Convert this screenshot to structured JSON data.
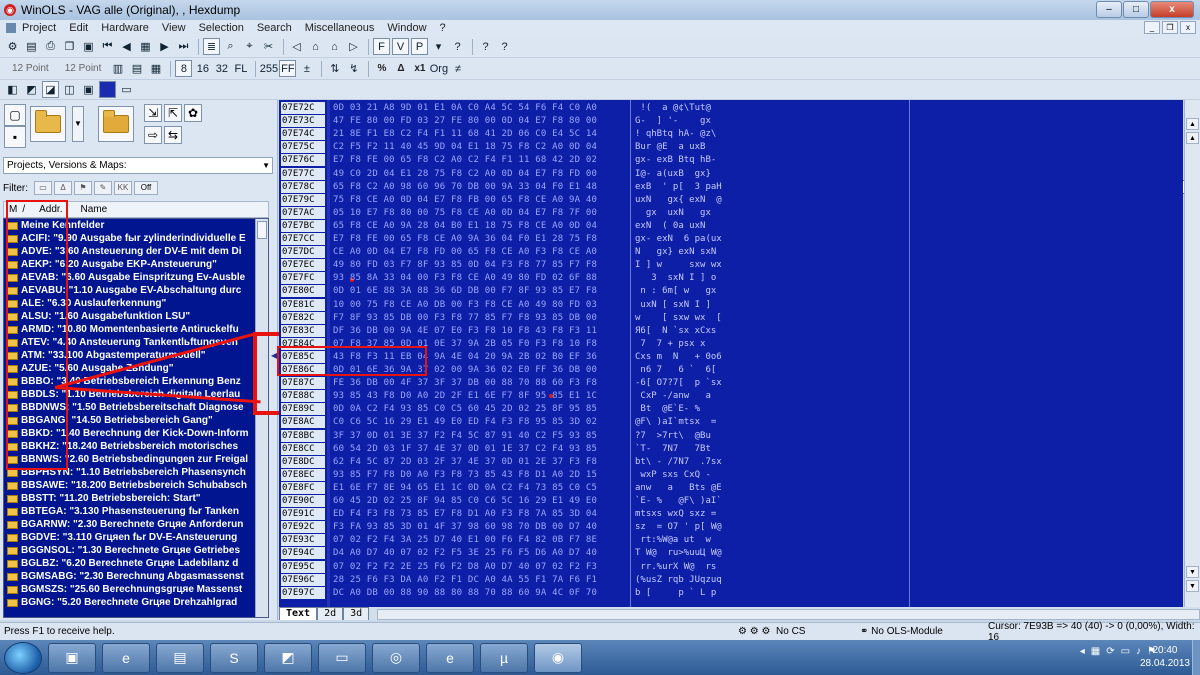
{
  "window": {
    "title": "WinOLS - VAG alle (Original), , Hexdump",
    "minimize": "–",
    "maximize": "□",
    "close": "x"
  },
  "menu": [
    "Project",
    "Edit",
    "Hardware",
    "View",
    "Selection",
    "Search",
    "Miscellaneous",
    "Window",
    "?"
  ],
  "toolbar": {
    "font_size_a": "12 Point",
    "font_size_b": "12 Point",
    "percent": "%",
    "delta": "Δ",
    "x1": "x1",
    "org": "Org",
    "hex_ff": "FF",
    "ff255": "255",
    "question": "?"
  },
  "left_panel": {
    "combo_label": "Projects, Versions & Maps:",
    "filter_label": "Filter:",
    "filter_off": "Off",
    "columns": [
      "M",
      "/",
      "Addr.",
      "Name"
    ],
    "items": [
      "Meine Kennfelder",
      "ACIFI: \"9.90 Ausgabe fыr zylinderindividuelle E",
      "ADVE: \"3.60 Ansteuerung der DV-E mit dem Di",
      "AEKP: \"6.20 Ausgabe EKP-Ansteuerung\"",
      "AEVAB: \"6.60 Ausgabe Einspritzung Ev-Ausble",
      "AEVABU: \"1.10 Ausgabe EV-Abschaltung durc",
      "ALE: \"6.30 Auslauferkennung\"",
      "ALSU: \"1.60 Ausgabefunktion LSU\"",
      "ARMD: \"10.80 Momentenbasierte Antiruckelfu",
      "ATEV: \"4.40 Ansteuerung Tankentlьftungsven",
      "ATM: \"33.100 Abgastemperaturmodell\"",
      "AZUE: \"5.60 Ausgabe Zьndung\"",
      "BBBO: \"3.40 Betriebsbereich Erkennung Benz",
      "BBDLS: \"1.10 Betriebsbereich digitale Leerlau",
      "BBDNWS: \"1.50 Betriebsbereitschaft Diagnose",
      "BBGANG: \"14.50 Betriebsbereich Gang\"",
      "BBKD: \"1.40 Berechnung der Kick-Down-Inform",
      "BBKHZ: \"18.240 Betriebsbereich motorisches",
      "BBNWS: \"2.60 Betriebsbedingungen zur Freigal",
      "BBPHSYN: \"1.10 Betriebsbereich Phasensynch",
      "BBSAWE: \"18.200 Betriebsbereich Schubabsch",
      "BBSTT: \"11.20 Betriebsbereich: Start\"",
      "BBTEGA: \"3.130 Phasensteuerung fьr Tanken",
      "BGARNW: \"2.30 Berechnete Grцяe Anforderun",
      "BGDVE: \"3.110 Grцяen fьr DV-E-Ansteuerung",
      "BGGNSOL: \"1.30 Berechnete Grцяe Getriebes",
      "BGLBZ: \"6.20 Berechnete Grцяe Ladebilanz d",
      "BGMSABG: \"2.30 Berechnung Abgasmassenst",
      "BGMSZS: \"25.60 Berechnungsgrцяe Massenst",
      "BGNG: \"5.20 Berechnete Grцяe Drehzahlgrad"
    ]
  },
  "hexdump": {
    "rows": [
      {
        "addr": "07E72C",
        "bytes": "0D 03 21 A8 9D 01 E1 0A C0 A4 5C 54 F6 F4 C0 A0",
        "ascii": " !(  a @¢\\Tut@"
      },
      {
        "addr": "07E73C",
        "bytes": "47 FE 80 00 FD 03 27 FE 80 00 0D 04 E7 F8 80 00",
        "ascii": "G-  ] '-    gx"
      },
      {
        "addr": "07E74C",
        "bytes": "21 8E F1 E8 C2 F4 F1 11 68 41 2D 06 C0 E4 5C 14",
        "ascii": "! qhBtq hA- @z\\"
      },
      {
        "addr": "07E75C",
        "bytes": "C2 F5 F2 11 40 45 9D 04 E1 18 75 F8 C2 A0 0D 04",
        "ascii": "Bur @E  a uxB"
      },
      {
        "addr": "07E76C",
        "bytes": "E7 F8 FE 00 65 F8 C2 A0 C2 F4 F1 11 68 42 2D 02",
        "ascii": "gx- exB Btq hB-"
      },
      {
        "addr": "07E77C",
        "bytes": "49 C0 2D 04 E1 28 75 F8 C2 A0 0D 04 E7 F8 FD 00",
        "ascii": "I@- a(uxB  gx}"
      },
      {
        "addr": "07E78C",
        "bytes": "65 F8 C2 A0 98 60 96 70 DB 00 9A 33 04 F0 E1 48",
        "ascii": "exB  ' p[  3 paH"
      },
      {
        "addr": "07E79C",
        "bytes": "75 F8 CE A0 0D 04 E7 F8 FB 00 65 F8 CE A0 9A 40",
        "ascii": "uxN   gx{ exN  @"
      },
      {
        "addr": "07E7AC",
        "bytes": "05 10 E7 F8 80 00 75 F8 CE A0 0D 04 E7 F8 7F 00",
        "ascii": "  gx  uxN   gx"
      },
      {
        "addr": "07E7BC",
        "bytes": "65 F8 CE A0 9A 28 04 B0 E1 18 75 F8 CE A0 0D 04",
        "ascii": "exN  ( 0a uxN"
      },
      {
        "addr": "07E7CC",
        "bytes": "E7 F8 FE 00 65 F8 CE A0 9A 36 04 F0 E1 28 75 F8",
        "ascii": "gx- exN  6 pa(ux"
      },
      {
        "addr": "07E7DC",
        "bytes": "CE A0 0D 04 E7 F8 FD 00 65 F8 CE A0 F3 F8 CE A0",
        "ascii": "N   gx} exN sxN"
      },
      {
        "addr": "07E7EC",
        "bytes": "49 80 FD 03 F7 8F 93 85 0D 04 F3 F8 77 85 F7 F8",
        "ascii": "I ] w     sxw wx"
      },
      {
        "addr": "07E7FC",
        "bytes": "93 85 8A 33 04 00 F3 F8 CE A0 49 80 FD 02 6F 88",
        "ascii": "   3  sxN I ] o"
      },
      {
        "addr": "07E80C",
        "bytes": "0D 01 6E 88 3A 88 36 6D DB 00 F7 8F 93 85 E7 F8",
        "ascii": " n : 6m[ w   gx"
      },
      {
        "addr": "07E81C",
        "bytes": "10 00 75 F8 CE A0 DB 00 F3 F8 CE A0 49 80 FD 03",
        "ascii": " uxN [ sxN I ]"
      },
      {
        "addr": "07E82C",
        "bytes": "F7 8F 93 85 DB 00 F3 F8 77 85 F7 F8 93 85 DB 00",
        "ascii": "w    [ sxw wx  ["
      },
      {
        "addr": "07E83C",
        "bytes": "DF 36 DB 00 9A 4E 07 E0 F3 F8 10 F8 43 F8 F3 11",
        "ascii": "Я6[  N `sx xCxs"
      },
      {
        "addr": "07E84C",
        "bytes": "07 F8 37 85 0D 01 0E 37 9A 2B 05 F0 F3 F8 10 F8",
        "ascii": " 7  7 + psx x"
      },
      {
        "addr": "07E85C",
        "bytes": "43 F8 F3 11 EB 04 9A 4E 04 20 9A 2B 02 B0 EF 36",
        "ascii": "Cxs m  N   + 0o6"
      },
      {
        "addr": "07E86C",
        "bytes": "0D 01 6E 36 9A 37 02 00 9A 36 02 E0 FF 36 DB 00",
        "ascii": " n6 7   6 `  6["
      },
      {
        "addr": "07E87C",
        "bytes": "FE 36 DB 00 4F 37 3F 37 DB 00 88 70 88 60 F3 F8",
        "ascii": "-6[ O7?7[  p `sx"
      },
      {
        "addr": "07E88C",
        "bytes": "93 85 43 F8 D0 A0 2D 2F E1 6E F7 8F 95 85 E1 1C",
        "ascii": " CxP -/anw   a"
      },
      {
        "addr": "07E89C",
        "bytes": "0D 0A C2 F4 93 85 C0 C5 60 45 2D 02 25 8F 95 85",
        "ascii": " Bt  @E`E- %"
      },
      {
        "addr": "07E8AC",
        "bytes": "C0 C6 5C 16 29 E1 49 E0 ED F4 F3 F8 95 85 3D 02",
        "ascii": "@F\\ )aI`mtsx  ="
      },
      {
        "addr": "07E8BC",
        "bytes": "3F 37 0D 01 3E 37 F2 F4 5C 87 91 40 C2 F5 93 85",
        "ascii": "?7  >7rt\\  @Bu"
      },
      {
        "addr": "07E8CC",
        "bytes": "60 54 2D 03 1F 37 4E 37 0D 01 1E 37 C2 F4 93 85",
        "ascii": "`T-  7N7   7Bt"
      },
      {
        "addr": "07E8DC",
        "bytes": "62 F4 5C 87 2D 03 2F 37 4E 37 0D 01 2E 37 F3 F8",
        "ascii": "bt\\ - /7N7  .7sx"
      },
      {
        "addr": "07E8EC",
        "bytes": "93 85 F7 F8 D0 A0 F3 F8 73 85 43 F8 D1 A0 2D 15",
        "ascii": " wxP sxs CxQ -"
      },
      {
        "addr": "07E8FC",
        "bytes": "E1 6E F7 8E 94 65 E1 1C 0D 0A C2 F4 73 85 C0 C5",
        "ascii": "anw   a   Bts @E"
      },
      {
        "addr": "07E90C",
        "bytes": "60 45 2D 02 25 8F 94 85 C0 C6 5C 16 29 E1 49 E0",
        "ascii": "`E- %   @F\\ )aI`"
      },
      {
        "addr": "07E91C",
        "bytes": "ED F4 F3 F8 73 85 E7 F8 D1 A0 F3 F8 7A 85 3D 04",
        "ascii": "mtsxs wxQ sxz ="
      },
      {
        "addr": "07E92C",
        "bytes": "F3 FA 93 85 3D 01 4F 37 98 60 98 70 DB 00 D7 40",
        "ascii": "sz  = O7 ' p[ W@"
      },
      {
        "addr": "07E93C",
        "bytes": "07 02 F2 F4 3A 25 D7 40 E1 00 F6 F4 82 0B F7 8E",
        "ascii": " rt:%W@a ut  w"
      },
      {
        "addr": "07E94C",
        "bytes": "D4 A0 D7 40 07 02 F2 F5 3E 25 F6 F5 D6 A0 D7 40",
        "ascii": "T W@  ru>%uuЦ W@"
      },
      {
        "addr": "07E95C",
        "bytes": "07 02 F2 F2 2E 25 F6 F2 D8 A0 D7 40 07 02 F2 F3",
        "ascii": " rr.%urX W@  rs"
      },
      {
        "addr": "07E96C",
        "bytes": "28 25 F6 F3 DA A0 F2 F1 DC A0 4A 55 F1 7A F6 F1",
        "ascii": "(%usZ rqb JUqzuq"
      },
      {
        "addr": "07E97C",
        "bytes": "DC A0 DB 00 88 90 88 80 88 70 88 60 9A 4C 0F 70",
        "ascii": "b [     p ` L p"
      }
    ]
  },
  "tabs": [
    "Text",
    "2d",
    "3d"
  ],
  "status": {
    "help": "Press F1 to receive help.",
    "no_cs": "No CS",
    "no_ols": "No OLS-Module",
    "cursor": "Cursor: 7E93B => 40 (40) -> 0 (0,00%), Width: 16"
  },
  "taskbar": {
    "time": "20:40",
    "date": "28.04.2013"
  },
  "colors": {
    "hex_bg": "#0d1fa6",
    "list_bg": "#00158f",
    "annotation": "#e8130f"
  }
}
